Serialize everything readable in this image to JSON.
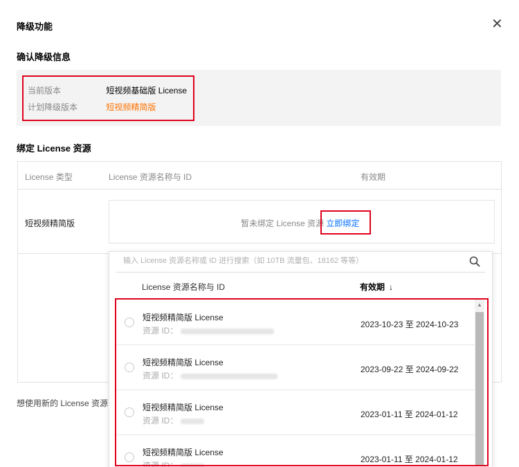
{
  "dialog": {
    "title": "降级功能",
    "close_icon": "close-icon"
  },
  "confirm": {
    "section_title": "确认降级信息",
    "current_label": "当前版本",
    "current_value": "短视频基础版 License",
    "planned_label": "计划降级版本",
    "planned_value": "短视频精简版"
  },
  "binding": {
    "section_title": "绑定 License 资源",
    "columns": [
      "License 类型",
      "License 资源名称与 ID",
      "有效期"
    ],
    "row_type": "短视频精简版",
    "unbound_text": "暂未绑定 License 资源",
    "bind_link": "立即绑定"
  },
  "footnote": "想使用新的 License 资源",
  "dropdown": {
    "search_placeholder": "输入 License 资源名称或 ID 进行搜索（如 10TB 流量包、18162 等等）",
    "col_name": "License 资源名称与 ID",
    "col_validity": "有效期",
    "sort_arrow": "↓",
    "id_label": "资源 ID：",
    "items": [
      {
        "name": "短视频精简版 License",
        "date": "2023-10-23 至 2024-10-23"
      },
      {
        "name": "短视频精简版 License",
        "date": "2023-09-22 至 2024-09-22"
      },
      {
        "name": "短视频精简版 License",
        "date": "2023-01-11 至 2024-01-12"
      },
      {
        "name": "短视频精简版 License",
        "date": "2023-01-11 至 2024-01-12"
      }
    ]
  },
  "colors": {
    "accent_orange": "#ff7200",
    "link_blue": "#006eff",
    "highlight_red": "#e0001b"
  }
}
